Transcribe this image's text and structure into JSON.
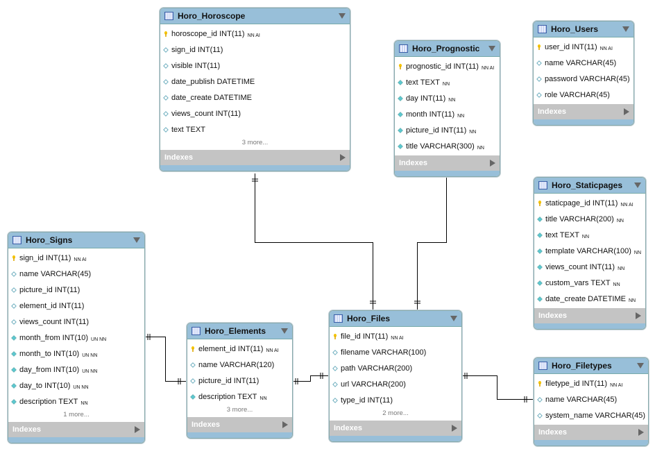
{
  "indexes_label": "Indexes",
  "tables": [
    {
      "id": "horoscope",
      "name": "Horo_Horoscope",
      "more": "3 more...",
      "columns": [
        {
          "name": "horoscope_id",
          "type": "INT(11)",
          "flags": "NN AI",
          "kind": "pk"
        },
        {
          "name": "sign_id",
          "type": "INT(11)",
          "flags": "",
          "kind": "null"
        },
        {
          "name": "visible",
          "type": "INT(11)",
          "flags": "",
          "kind": "null"
        },
        {
          "name": "date_publish",
          "type": "DATETIME",
          "flags": "",
          "kind": "null"
        },
        {
          "name": "date_create",
          "type": "DATETIME",
          "flags": "",
          "kind": "null"
        },
        {
          "name": "views_count",
          "type": "INT(11)",
          "flags": "",
          "kind": "null"
        },
        {
          "name": "text",
          "type": "TEXT",
          "flags": "",
          "kind": "null"
        }
      ]
    },
    {
      "id": "prognostic",
      "name": "Horo_Prognostic",
      "more": "",
      "columns": [
        {
          "name": "prognostic_id",
          "type": "INT(11)",
          "flags": "NN AI",
          "kind": "pk"
        },
        {
          "name": "text",
          "type": "TEXT",
          "flags": "NN",
          "kind": "nn"
        },
        {
          "name": "day",
          "type": "INT(11)",
          "flags": "NN",
          "kind": "nn"
        },
        {
          "name": "month",
          "type": "INT(11)",
          "flags": "NN",
          "kind": "nn"
        },
        {
          "name": "picture_id",
          "type": "INT(11)",
          "flags": "NN",
          "kind": "nn"
        },
        {
          "name": "title",
          "type": "VARCHAR(300)",
          "flags": "NN",
          "kind": "nn"
        }
      ]
    },
    {
      "id": "users",
      "name": "Horo_Users",
      "more": "",
      "columns": [
        {
          "name": "user_id",
          "type": "INT(11)",
          "flags": "NN AI",
          "kind": "pk"
        },
        {
          "name": "name",
          "type": "VARCHAR(45)",
          "flags": "",
          "kind": "null"
        },
        {
          "name": "password",
          "type": "VARCHAR(45)",
          "flags": "",
          "kind": "null"
        },
        {
          "name": "role",
          "type": "VARCHAR(45)",
          "flags": "",
          "kind": "null"
        }
      ]
    },
    {
      "id": "staticpages",
      "name": "Horo_Staticpages",
      "more": "",
      "columns": [
        {
          "name": "staticpage_id",
          "type": "INT(11)",
          "flags": "NN AI",
          "kind": "pk"
        },
        {
          "name": "title",
          "type": "VARCHAR(200)",
          "flags": "NN",
          "kind": "nn"
        },
        {
          "name": "text",
          "type": "TEXT",
          "flags": "NN",
          "kind": "nn"
        },
        {
          "name": "template",
          "type": "VARCHAR(100)",
          "flags": "NN",
          "kind": "nn"
        },
        {
          "name": "views_count",
          "type": "INT(11)",
          "flags": "NN",
          "kind": "nn"
        },
        {
          "name": "custom_vars",
          "type": "TEXT",
          "flags": "NN",
          "kind": "nn"
        },
        {
          "name": "date_create",
          "type": "DATETIME",
          "flags": "NN",
          "kind": "nn"
        }
      ]
    },
    {
      "id": "signs",
      "name": "Horo_Signs",
      "more": "1 more...",
      "columns": [
        {
          "name": "sign_id",
          "type": "INT(11)",
          "flags": "NN AI",
          "kind": "pk"
        },
        {
          "name": "name",
          "type": "VARCHAR(45)",
          "flags": "",
          "kind": "null"
        },
        {
          "name": "picture_id",
          "type": "INT(11)",
          "flags": "",
          "kind": "null"
        },
        {
          "name": "element_id",
          "type": "INT(11)",
          "flags": "",
          "kind": "null"
        },
        {
          "name": "views_count",
          "type": "INT(11)",
          "flags": "",
          "kind": "null"
        },
        {
          "name": "month_from",
          "type": "INT(10)",
          "flags": "UN NN",
          "kind": "nn"
        },
        {
          "name": "month_to",
          "type": "INT(10)",
          "flags": "UN NN",
          "kind": "nn"
        },
        {
          "name": "day_from",
          "type": "INT(10)",
          "flags": "UN NN",
          "kind": "nn"
        },
        {
          "name": "day_to",
          "type": "INT(10)",
          "flags": "UN NN",
          "kind": "nn"
        },
        {
          "name": "description",
          "type": "TEXT",
          "flags": "NN",
          "kind": "nn"
        }
      ]
    },
    {
      "id": "elements",
      "name": "Horo_Elements",
      "more": "3 more...",
      "columns": [
        {
          "name": "element_id",
          "type": "INT(11)",
          "flags": "NN AI",
          "kind": "pk"
        },
        {
          "name": "name",
          "type": "VARCHAR(120)",
          "flags": "",
          "kind": "null"
        },
        {
          "name": "picture_id",
          "type": "INT(11)",
          "flags": "",
          "kind": "null"
        },
        {
          "name": "description",
          "type": "TEXT",
          "flags": "NN",
          "kind": "nn"
        }
      ]
    },
    {
      "id": "files",
      "name": "Horo_Files",
      "more": "2 more...",
      "columns": [
        {
          "name": "file_id",
          "type": "INT(11)",
          "flags": "NN AI",
          "kind": "pk"
        },
        {
          "name": "filename",
          "type": "VARCHAR(100)",
          "flags": "",
          "kind": "null"
        },
        {
          "name": "path",
          "type": "VARCHAR(200)",
          "flags": "",
          "kind": "null"
        },
        {
          "name": "url",
          "type": "VARCHAR(200)",
          "flags": "",
          "kind": "null"
        },
        {
          "name": "type_id",
          "type": "INT(11)",
          "flags": "",
          "kind": "null"
        }
      ]
    },
    {
      "id": "filetypes",
      "name": "Horo_Filetypes",
      "more": "",
      "columns": [
        {
          "name": "filetype_id",
          "type": "INT(11)",
          "flags": "NN AI",
          "kind": "pk"
        },
        {
          "name": "name",
          "type": "VARCHAR(45)",
          "flags": "",
          "kind": "null"
        },
        {
          "name": "system_name",
          "type": "VARCHAR(45)",
          "flags": "",
          "kind": "null"
        }
      ]
    }
  ],
  "relationships": [
    {
      "from": "horoscope",
      "to": "files",
      "cardinality": "one-to-one"
    },
    {
      "from": "prognostic",
      "to": "files",
      "cardinality": "one-to-one"
    },
    {
      "from": "signs",
      "to": "elements",
      "cardinality": "one-to-one"
    },
    {
      "from": "elements",
      "to": "files",
      "cardinality": "one-to-one"
    },
    {
      "from": "files",
      "to": "filetypes",
      "cardinality": "one-to-one"
    }
  ],
  "colors": {
    "header": "#98bfd9",
    "indexes": "#c4c4c4",
    "key": "#f5c400",
    "nn_diamond": "#5cc8d0"
  }
}
